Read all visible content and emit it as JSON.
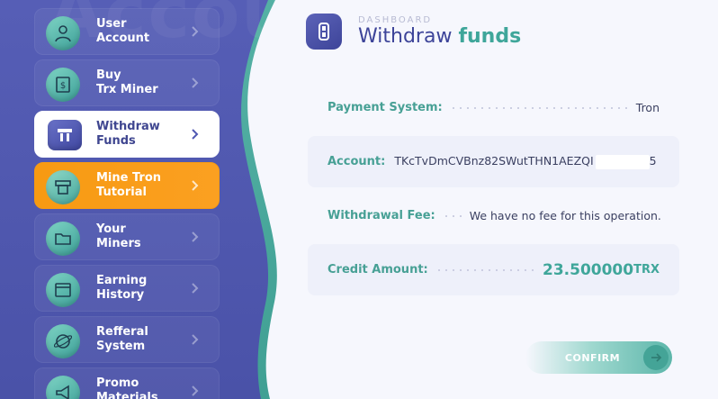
{
  "sidebar": {
    "watermark": "Account",
    "items": [
      {
        "label": "User\nAccount",
        "icon": "user-icon",
        "state": "normal"
      },
      {
        "label": "Buy\nTrx Miner",
        "icon": "receipt-icon",
        "state": "normal"
      },
      {
        "label": "Withdraw\nFunds",
        "icon": "withdraw-icon",
        "state": "active"
      },
      {
        "label": "Mine Tron\nTutorial",
        "icon": "atm-icon",
        "state": "highlight"
      },
      {
        "label": "Your\nMiners",
        "icon": "folder-icon",
        "state": "normal"
      },
      {
        "label": "Earning\nHistory",
        "icon": "window-icon",
        "state": "normal"
      },
      {
        "label": "Refferal\nSystem",
        "icon": "globe-icon",
        "state": "normal"
      },
      {
        "label": "Promo\nMaterials",
        "icon": "megaphone-icon",
        "state": "normal"
      }
    ]
  },
  "header": {
    "eyebrow": "DASHBOARD",
    "title_main": "Withdraw",
    "title_accent": "funds",
    "logo_icon": "wallet-logo-icon"
  },
  "form": {
    "payment_system": {
      "label": "Payment System:",
      "value": "Tron"
    },
    "account": {
      "label": "Account:",
      "value": "TKcTvDmCVBnz82SWutTHN1AEZQI",
      "tail": "5"
    },
    "fee": {
      "label": "Withdrawal Fee:",
      "value": "We have no fee for this operation."
    },
    "credit": {
      "label": "Credit Amount:",
      "value": "23.500000",
      "unit": "TRX"
    }
  },
  "confirm": {
    "label": "CONFIRM"
  },
  "colors": {
    "sidebar": "#5058b2",
    "accent_teal": "#3fa69a",
    "accent_orange": "#f79a12",
    "title_blue": "#3d4499"
  }
}
